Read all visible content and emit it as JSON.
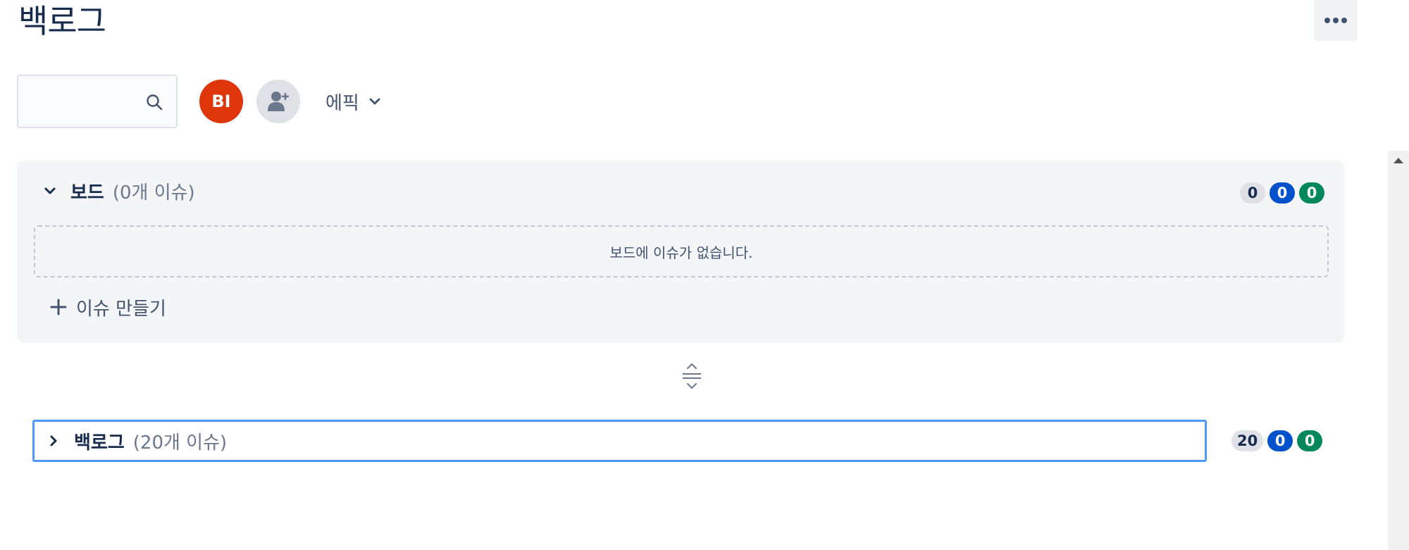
{
  "page": {
    "title": "백로그"
  },
  "toolbar": {
    "search_value": "",
    "search_placeholder": "",
    "avatar_initials": "BI",
    "epic_label": "에픽"
  },
  "board_section": {
    "name": "보드",
    "count_text": "(0개 이슈)",
    "badges": [
      "0",
      "0",
      "0"
    ],
    "empty_message": "보드에 이슈가 없습니다.",
    "create_label": "이슈 만들기",
    "expanded": true
  },
  "backlog_section": {
    "name": "백로그",
    "count_text": "(20개 이슈)",
    "badges": [
      "20",
      "0",
      "0"
    ],
    "expanded": false
  },
  "colors": {
    "avatar": "#de350b",
    "badge_blue": "#0052cc",
    "badge_green": "#00875a",
    "focus_border": "#4c9aff"
  },
  "icons": [
    "more-icon",
    "search-icon",
    "add-user-icon",
    "chevron-down-icon",
    "chevron-right-icon",
    "plus-icon",
    "drag-handle-icon",
    "scroll-up-icon"
  ]
}
